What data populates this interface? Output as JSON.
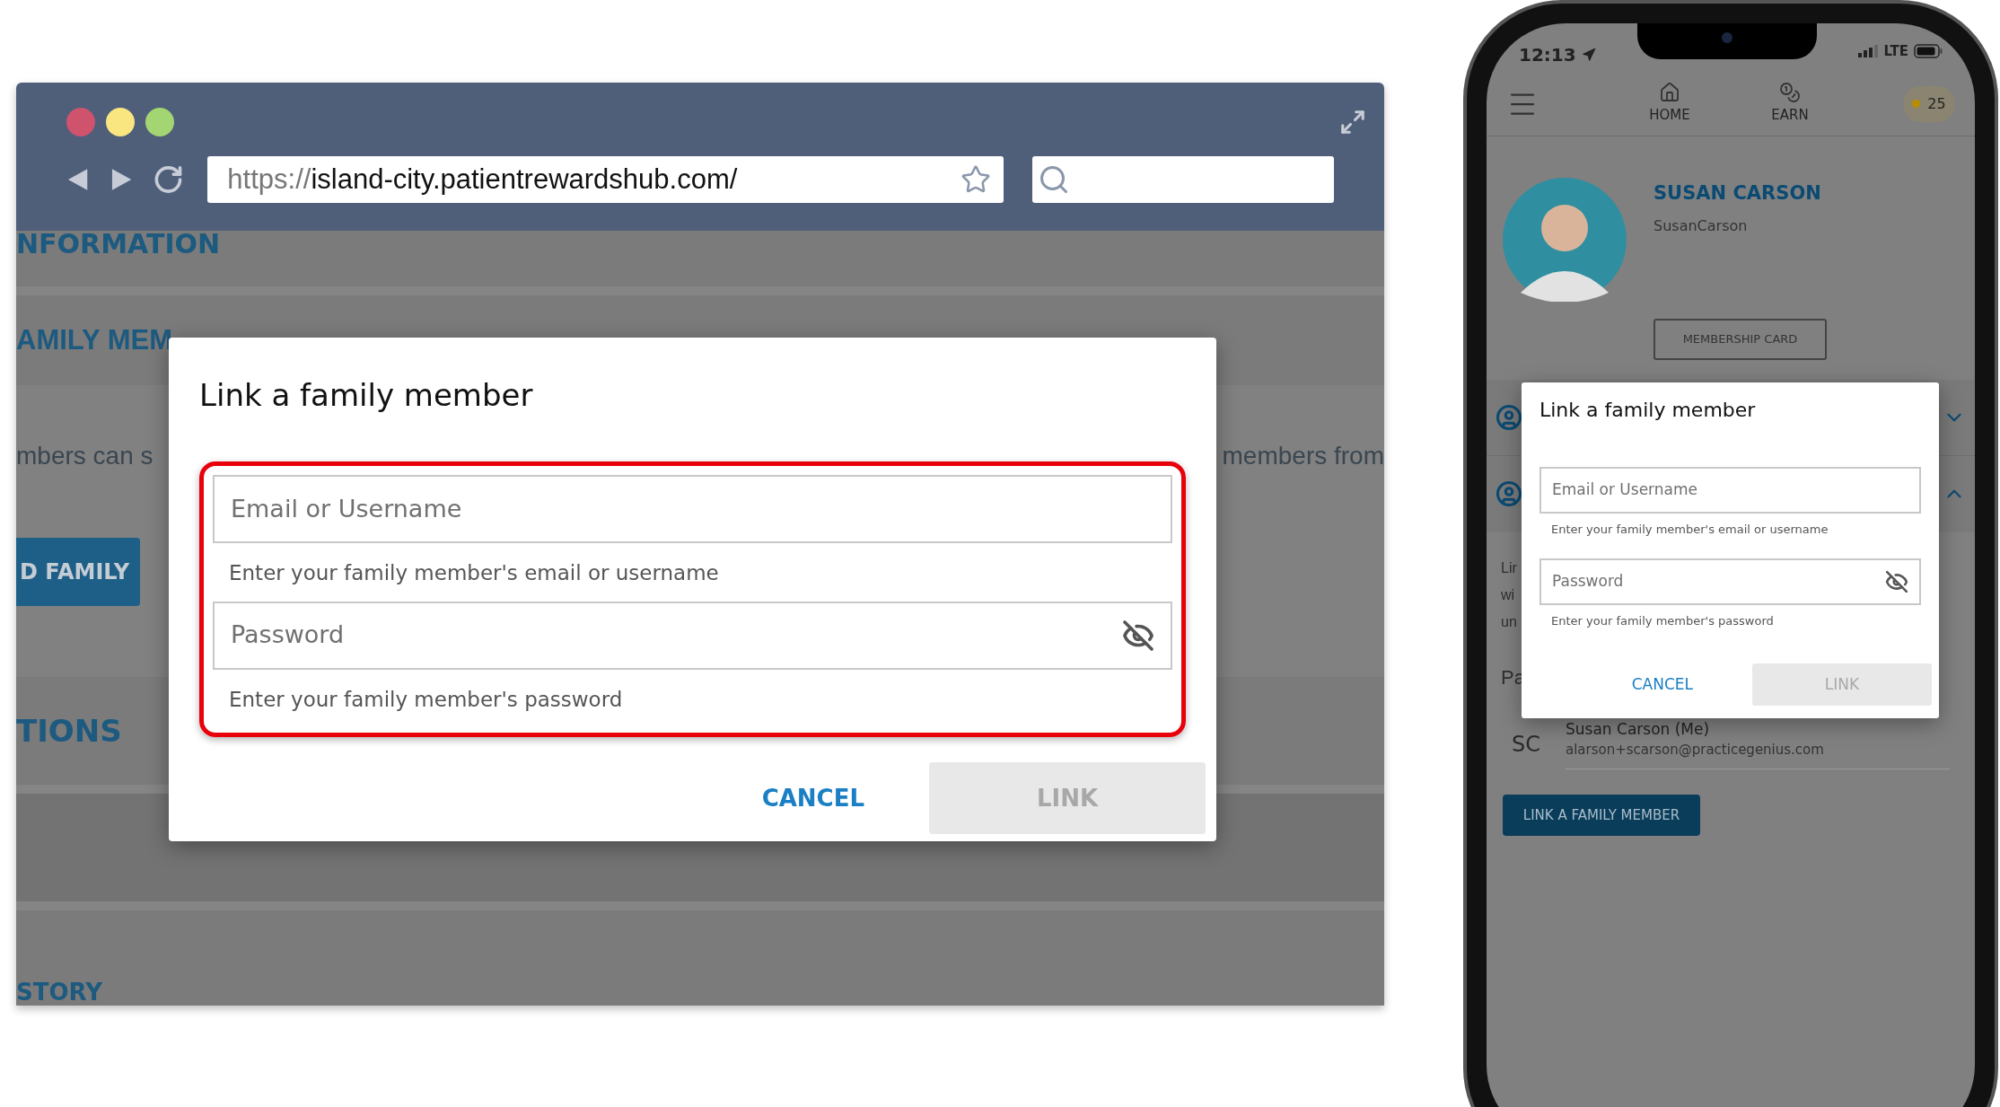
{
  "browser": {
    "url": {
      "scheme": "https://",
      "rest": "island-city.patientrewardshub.com/"
    },
    "background_page": {
      "heading_1": "NFORMATION",
      "heading_2": "AMILY MEM",
      "text_left": "mbers can s",
      "text_right": "members from",
      "button": "D FAMILY",
      "heading_3": "TIONS",
      "heading_4": "STORY"
    },
    "dialog": {
      "title": "Link a family member",
      "highlighted": true,
      "fields": [
        {
          "kind": "text",
          "placeholder": "Email or Username",
          "helper": "Enter your family member's email or username"
        },
        {
          "kind": "password",
          "placeholder": "Password",
          "helper": "Enter your family member's password"
        }
      ],
      "cancel": "CANCEL",
      "link": {
        "label": "LINK",
        "disabled": true
      }
    }
  },
  "phone": {
    "status_bar": {
      "time": "12:13",
      "network": "LTE"
    },
    "nav": {
      "items": [
        {
          "kind": "home",
          "label": "HOME"
        },
        {
          "kind": "earn",
          "label": "EARN"
        }
      ],
      "points": "25"
    },
    "profile": {
      "name": "SUSAN CARSON",
      "username": "SusanCarson",
      "button": "MEMBERSHIP CARD"
    },
    "background_page": {
      "lines": [
        "Lir",
        "wi",
        "un"
      ],
      "heading": "Pa",
      "member": {
        "initials": "SC",
        "name": "Susan Carson (Me)",
        "email": "alarson+scarson@practicegenius.com"
      },
      "button": "LINK A FAMILY MEMBER"
    },
    "dialog": {
      "title": "Link a family member",
      "highlighted": false,
      "fields": [
        {
          "kind": "text",
          "placeholder": "Email or Username",
          "helper": "Enter your family member's email or username"
        },
        {
          "kind": "password",
          "placeholder": "Password",
          "helper": "Enter your family member's password"
        }
      ],
      "cancel": "CANCEL",
      "link": {
        "label": "LINK",
        "disabled": true
      }
    }
  }
}
